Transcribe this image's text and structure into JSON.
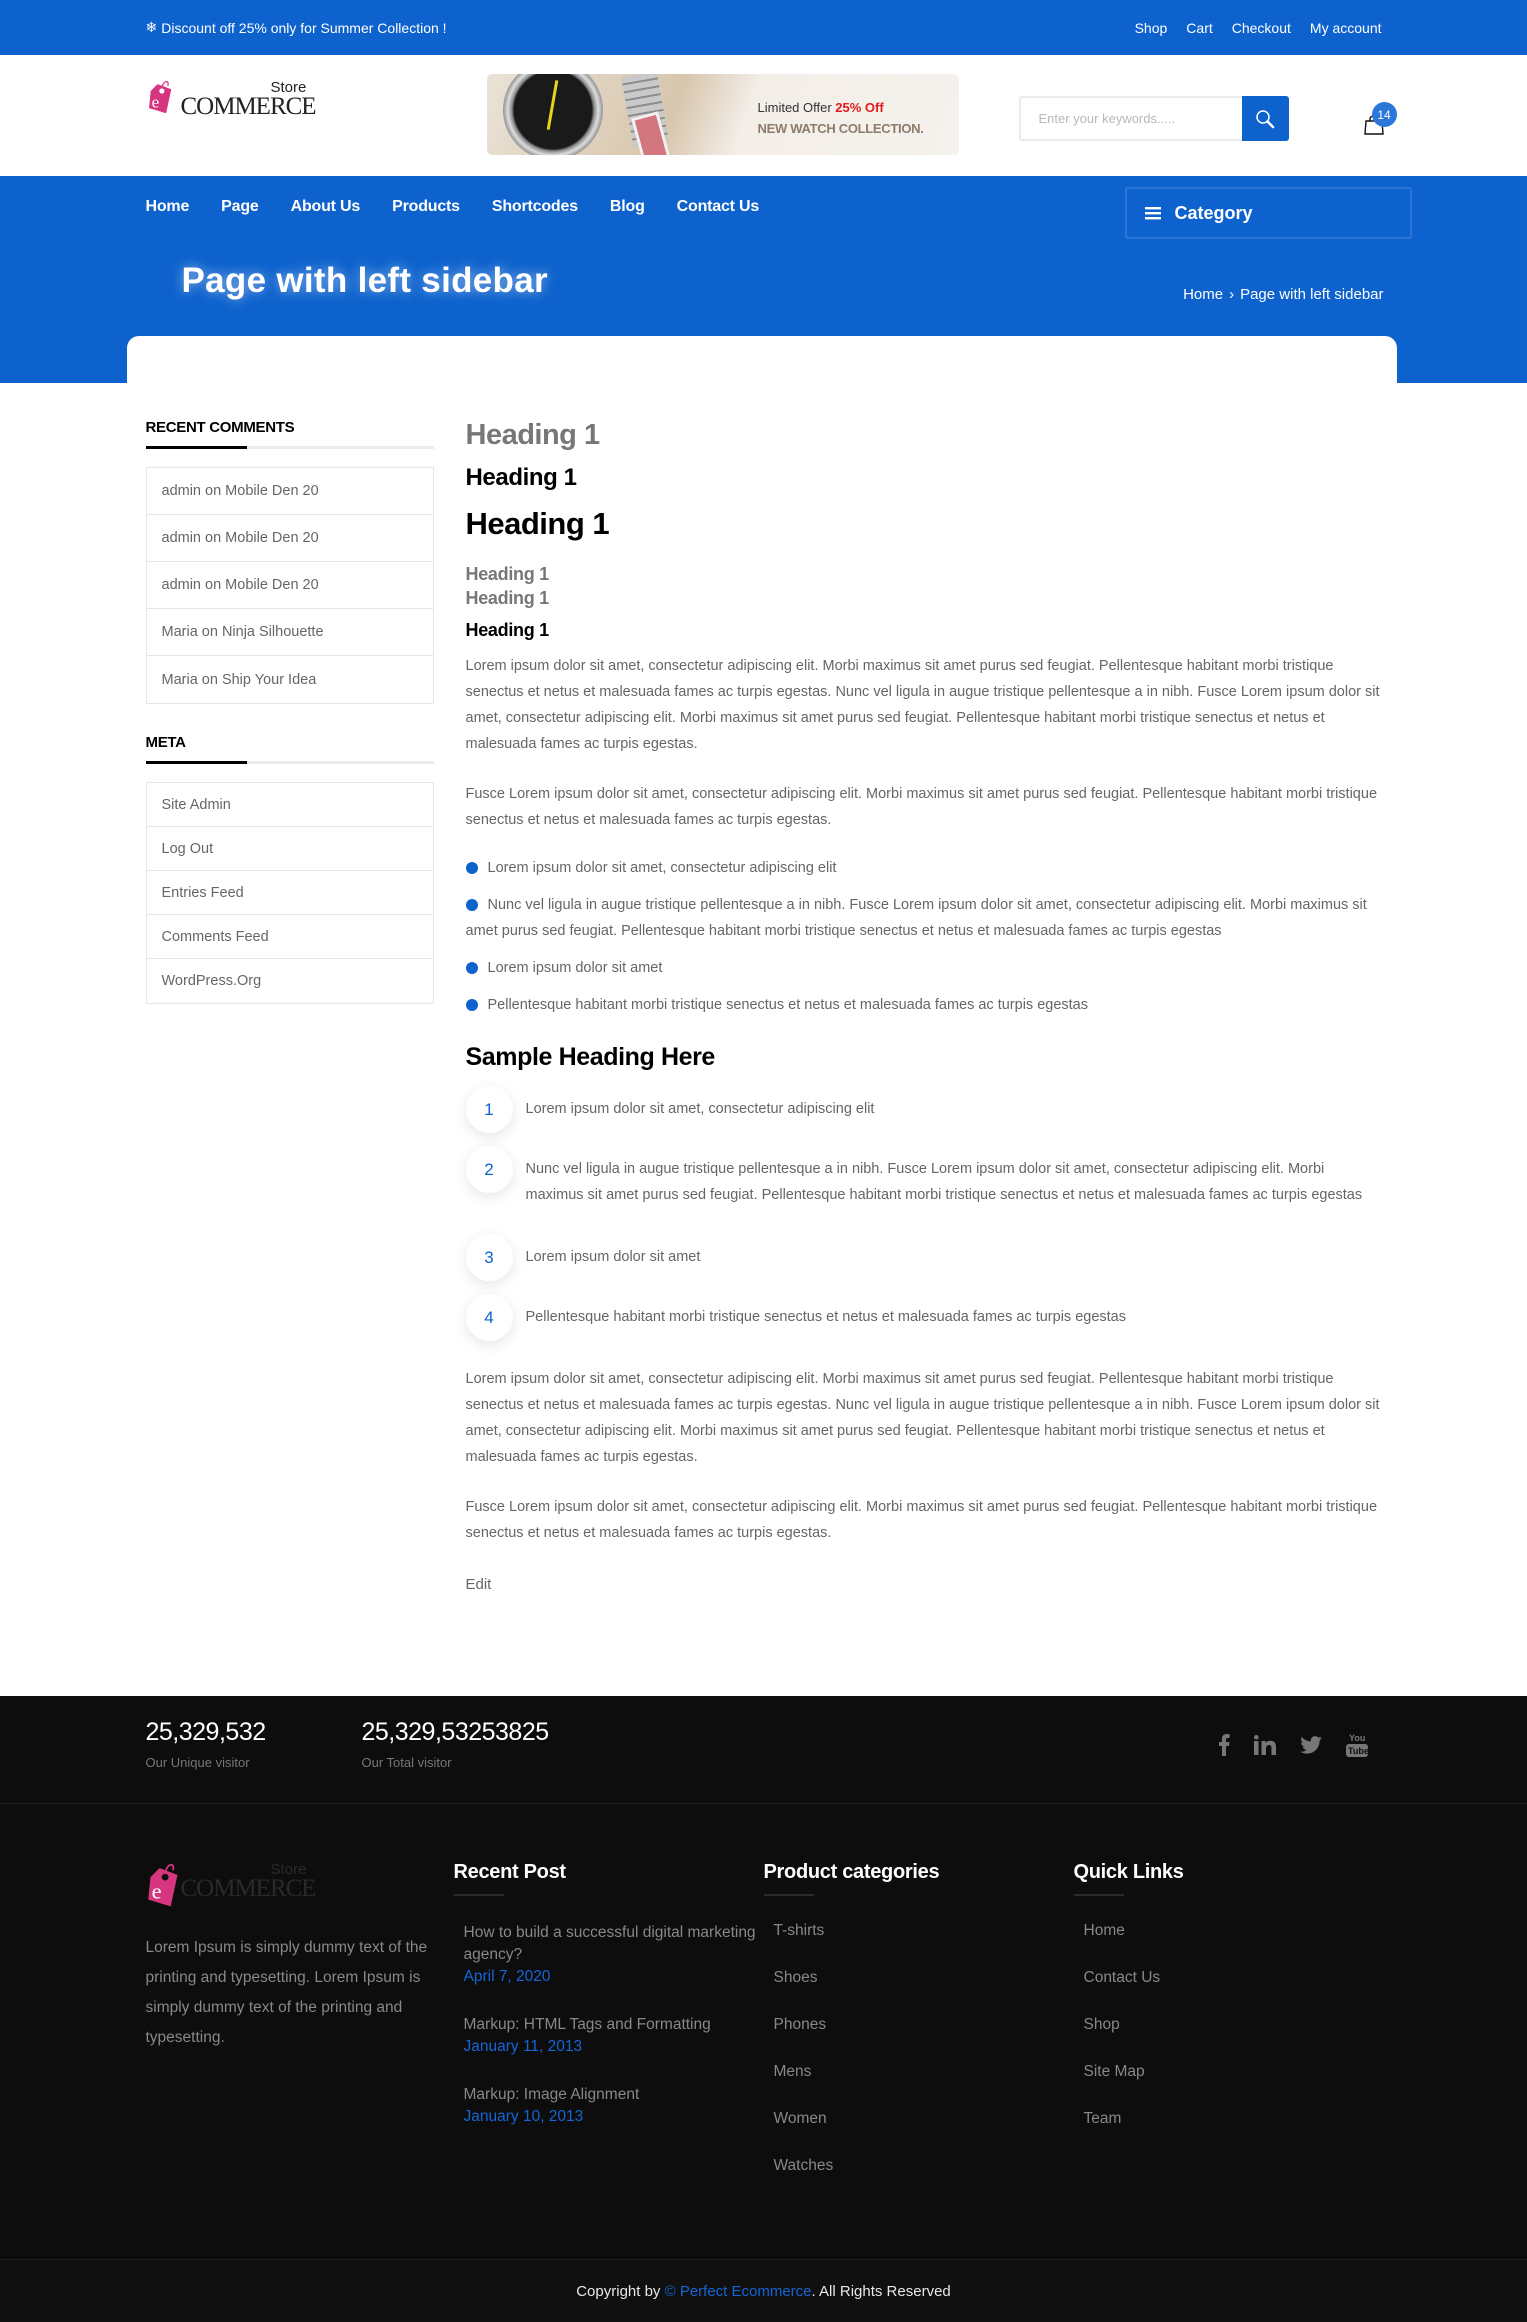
{
  "topbar": {
    "promo_icon": "snowflake-icon",
    "promo_text": "Discount off 25% only for Summer Collection !",
    "links": [
      "Shop",
      "Cart",
      "Checkout",
      "My account"
    ]
  },
  "header": {
    "logo": {
      "store": "Store",
      "commerce": "COMMERCE",
      "letter": "e"
    },
    "banner": {
      "offer_prefix": "Limited Offer ",
      "offer_highlight": "25% Off",
      "collection": "NEW WATCH COLLECTION."
    },
    "search": {
      "placeholder": "Enter your keywords.....",
      "value": "",
      "icon": "search-icon"
    },
    "cart": {
      "icon": "shopping-bag-icon",
      "count": "14"
    }
  },
  "nav": {
    "items": [
      "Home",
      "Page",
      "About Us",
      "Products",
      "Shortcodes",
      "Blog",
      "Contact Us"
    ],
    "category_label": "Category",
    "category_icon": "hamburger-icon"
  },
  "hero": {
    "title": "Page with left sidebar",
    "breadcrumb": {
      "home": "Home",
      "separator": "›",
      "current": "Page with left sidebar"
    }
  },
  "sidebar": {
    "recent_comments": {
      "title": "RECENT COMMENTS",
      "items": [
        "admin on Mobile Den 20",
        "admin on Mobile Den 20",
        "admin on Mobile Den 20",
        "Maria on Ninja Silhouette",
        "Maria on Ship Your Idea"
      ]
    },
    "meta": {
      "title": "META",
      "items": [
        "Site Admin",
        "Log Out",
        "Entries Feed",
        "Comments Feed",
        "WordPress.Org"
      ]
    }
  },
  "content": {
    "headings": [
      "Heading 1",
      "Heading 1",
      "Heading 1",
      "Heading 1",
      "Heading 1",
      "Heading 1"
    ],
    "paragraph_1": "Lorem ipsum dolor sit amet, consectetur adipiscing elit. Morbi maximus sit amet purus sed feugiat. Pellentesque habitant morbi tristique senectus et netus et malesuada fames ac turpis egestas. Nunc vel ligula in augue tristique pellentesque a in nibh. Fusce Lorem ipsum dolor sit amet, consectetur adipiscing elit. Morbi maximus sit amet purus sed feugiat. Pellentesque habitant morbi tristique senectus et netus et malesuada fames ac turpis egestas.",
    "paragraph_2": "Fusce Lorem ipsum dolor sit amet, consectetur adipiscing elit. Morbi maximus sit amet purus sed feugiat. Pellentesque habitant morbi tristique senectus et netus et malesuada fames ac turpis egestas.",
    "bullets": [
      "Lorem ipsum dolor sit amet, consectetur adipiscing elit",
      "Nunc vel ligula in augue tristique pellentesque a in nibh. Fusce Lorem ipsum dolor sit amet, consectetur adipiscing elit. Morbi maximus sit amet purus sed feugiat. Pellentesque habitant morbi tristique senectus et netus et malesuada fames ac turpis egestas",
      "Lorem ipsum dolor sit amet",
      "Pellentesque habitant morbi tristique senectus et netus et malesuada fames ac turpis egestas"
    ],
    "sample_heading": "Sample Heading Here",
    "numbered": [
      {
        "num": "1",
        "text": "Lorem ipsum dolor sit amet, consectetur adipiscing elit"
      },
      {
        "num": "2",
        "text": "Nunc vel ligula in augue tristique pellentesque a in nibh. Fusce Lorem ipsum dolor sit amet, consectetur adipiscing elit. Morbi maximus sit amet purus sed feugiat. Pellentesque habitant morbi tristique senectus et netus et malesuada fames ac turpis egestas"
      },
      {
        "num": "3",
        "text": "Lorem ipsum dolor sit amet"
      },
      {
        "num": "4",
        "text": "Pellentesque habitant morbi tristique senectus et netus et malesuada fames ac turpis egestas"
      }
    ],
    "paragraph_3": "Lorem ipsum dolor sit amet, consectetur adipiscing elit. Morbi maximus sit amet purus sed feugiat. Pellentesque habitant morbi tristique senectus et netus et malesuada fames ac turpis egestas. Nunc vel ligula in augue tristique pellentesque a in nibh. Fusce Lorem ipsum dolor sit amet, consectetur adipiscing elit. Morbi maximus sit amet purus sed feugiat. Pellentesque habitant morbi tristique senectus et netus et malesuada fames ac turpis egestas.",
    "paragraph_4": "Fusce Lorem ipsum dolor sit amet, consectetur adipiscing elit. Morbi maximus sit amet purus sed feugiat. Pellentesque habitant morbi tristique senectus et netus et malesuada fames ac turpis egestas.",
    "edit_label": "Edit"
  },
  "footer": {
    "stats": [
      {
        "value": "25,329,532",
        "label": "Our Unique visitor"
      },
      {
        "value": "25,329,53253825",
        "label": "Our Total visitor"
      }
    ],
    "social": [
      "facebook-icon",
      "linkedin-icon",
      "twitter-icon",
      "youtube-icon"
    ],
    "about": "Lorem Ipsum is simply dummy text of the printing and typesetting. Lorem Ipsum is simply dummy text of the printing and typesetting.",
    "recent_post": {
      "title": "Recent Post",
      "items": [
        {
          "title": "How to build a successful digital marketing agency?",
          "date": "April 7, 2020"
        },
        {
          "title": "Markup: HTML Tags and Formatting",
          "date": "January 11, 2013"
        },
        {
          "title": "Markup: Image Alignment",
          "date": "January 10, 2013"
        }
      ]
    },
    "product_categories": {
      "title": "Product categories",
      "items": [
        "T-shirts",
        "Shoes",
        "Phones",
        "Mens",
        "Women",
        "Watches"
      ]
    },
    "quick_links": {
      "title": "Quick Links",
      "items": [
        "Home",
        "Contact Us",
        "Shop",
        "Site Map",
        "Team"
      ]
    },
    "copyright": {
      "prefix": "Copyright by ",
      "brand": "© Perfect Ecommerce",
      "suffix": ". All Rights Reserved"
    }
  },
  "colors": {
    "primary": "#0d62cd",
    "offer_red": "#e21b1b",
    "logo_pink": "#d6367f",
    "footer_bg": "#0d0d0d",
    "link_blue": "#1565d8"
  }
}
